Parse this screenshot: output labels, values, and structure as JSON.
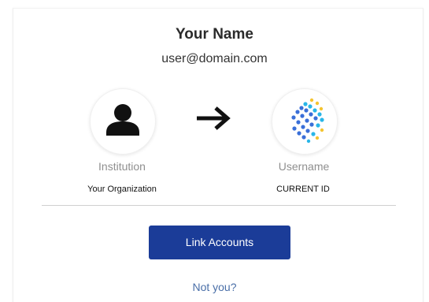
{
  "user": {
    "name": "Your Name",
    "email": "user@domain.com"
  },
  "link_flow": {
    "from": {
      "type_label": "Institution",
      "value": "Your Organization",
      "icon": "person-icon"
    },
    "arrow_icon": "arrow-right-icon",
    "to": {
      "type_label": "Username",
      "value": "CURRENT ID",
      "icon": "brand-logo-icon"
    }
  },
  "actions": {
    "link_accounts_label": "Link Accounts",
    "not_you_label": "Not you?"
  },
  "colors": {
    "primary_button": "#1b3c98",
    "link_text": "#4a6fa8",
    "logo_blue": "#3a6fd8",
    "logo_cyan": "#29b6e8",
    "logo_yellow": "#f4c430"
  }
}
